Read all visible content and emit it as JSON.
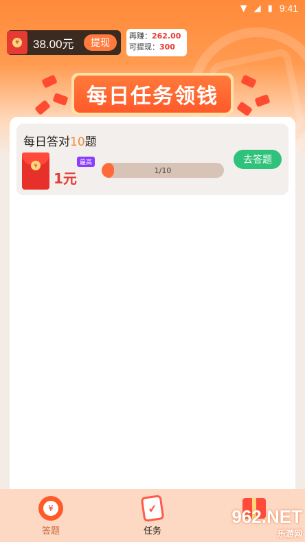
{
  "status_bar": {
    "time": "9:41"
  },
  "balance": {
    "amount": "38.00元",
    "withdraw_label": "提现",
    "coin_symbol": "¥"
  },
  "earn": {
    "more_label": "再赚：",
    "more_value": "262.00",
    "withdrawable_label": "可提现：",
    "withdrawable_value": "300"
  },
  "banner": {
    "title": "每日任务领钱"
  },
  "task": {
    "title_prefix": "每日答对",
    "title_num": "10",
    "title_suffix": "题",
    "reward": "1元",
    "badge": "最高",
    "progress_text": "1/10",
    "progress_fraction": 0.1,
    "button_label": "去答题",
    "coin_symbol": "¥"
  },
  "nav": {
    "items": [
      {
        "label": "答题",
        "icon": "red-packet-icon"
      },
      {
        "label": "任务",
        "icon": "task-clipboard-icon"
      },
      {
        "label": "",
        "icon": "gift-icon"
      }
    ]
  },
  "watermark": {
    "big": "962.NET",
    "small": "乐游网"
  },
  "colors": {
    "accent": "#ff7a3c",
    "green": "#2fc27a",
    "red": "#e53b33"
  }
}
